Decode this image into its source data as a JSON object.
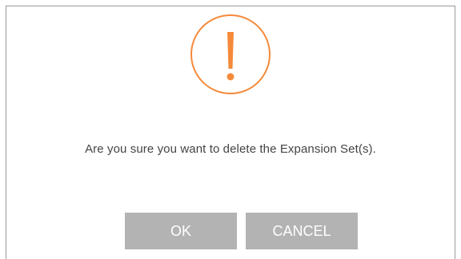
{
  "dialog": {
    "icon": "warning-exclamation-icon",
    "accent_color": "#f58a3a",
    "message": "Are you sure you want to delete the Expansion Set(s).",
    "buttons": {
      "ok_label": "OK",
      "cancel_label": "CANCEL",
      "button_color": "#b3b3b3"
    }
  }
}
